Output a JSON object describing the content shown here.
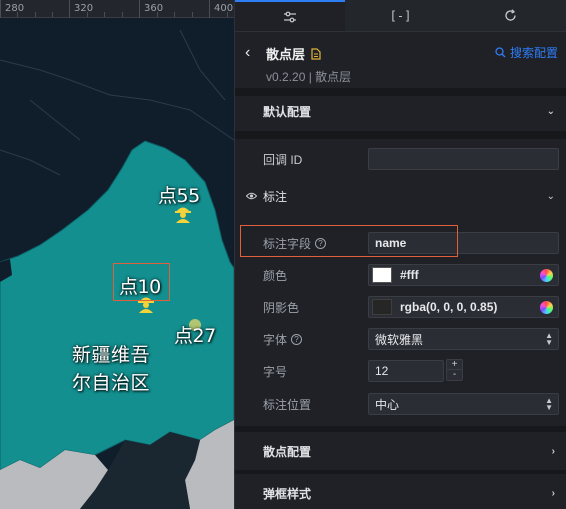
{
  "ruler": {
    "ticks": [
      "280",
      "320",
      "360",
      "400"
    ]
  },
  "map": {
    "points": [
      {
        "label": "点55"
      },
      {
        "label": "点10"
      },
      {
        "label": "点27"
      }
    ],
    "region_line1": "新疆维吾",
    "region_line2": "尔自治区",
    "colors": {
      "land": "#138f8f",
      "sea": "#0f1e2a",
      "gray_land": "#b9bbbe",
      "highlight": "#e0603c"
    }
  },
  "tabs": [
    {
      "icon": "sliders-icon"
    },
    {
      "icon": "bracket-icon",
      "label": "[-]"
    },
    {
      "icon": "refresh-icon"
    }
  ],
  "header": {
    "back_icon": "‹",
    "title": "散点层",
    "version": "v0.2.20 | 散点层",
    "search_label": "搜索配置"
  },
  "sections": {
    "default": "默认配置",
    "callback_label": "回调 ID",
    "callback_value": "",
    "annotation": "标注",
    "scatter": "散点配置",
    "popup": "弹框样式"
  },
  "annotation": {
    "field_label": "标注字段",
    "field_value": "name",
    "color_label": "颜色",
    "color_value": "#fff",
    "shadow_label": "阴影色",
    "shadow_value": "rgba(0, 0, 0, 0.85)",
    "font_label": "字体",
    "font_value": "微软雅黑",
    "size_label": "字号",
    "size_value": "12",
    "position_label": "标注位置",
    "position_value": "中心"
  },
  "colors": {
    "accent": "#2f7df6",
    "panel_bg": "#1f2126"
  }
}
